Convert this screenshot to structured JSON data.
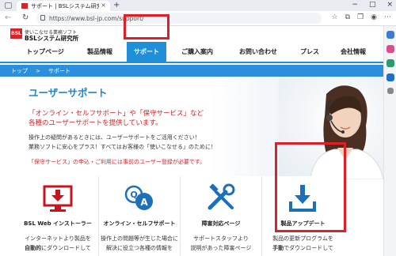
{
  "browser": {
    "tab_title": "サポート | BSLシステム研究所",
    "tab_close": "×",
    "new_tab": "+",
    "url": "https://www.bsl-jp.com/support/",
    "window_controls": [
      "−",
      "□",
      "×"
    ]
  },
  "site": {
    "logo_mark": "BSL",
    "logo_tagline": "使いこなせる業務ソフト",
    "logo_name": "BSLシステム研究所"
  },
  "nav": {
    "items": [
      "トップページ",
      "製品情報",
      "サポート",
      "ご購入案内",
      "お問い合わせ",
      "プレス",
      "会社情報"
    ],
    "active": "サポート"
  },
  "breadcrumb": {
    "home": "トップ",
    "sep": ">",
    "current": "サポート"
  },
  "hero": {
    "title": "ユーザーサポート",
    "lead1": "「オンライン・セルフサポート」や「保守サービス」など",
    "lead2": "各種のユーザーサポートを提供しています。",
    "text1": "操作上の疑問があるときには、ユーザーサポートをご活用ください！",
    "text2": "業務ソフトに安心をプラス！すべてはお客様の「使いこなせる」のために！",
    "note": "「保守サービス」の申込・ご利用には事前のユーザー登録が必要です。"
  },
  "cards": [
    {
      "title": "BSL Web インストーラー",
      "desc1": "インターネットより製品を",
      "desc2_bold": "自動的",
      "desc2_rest": "にダウンロードして",
      "icon": "download-monitor-icon"
    },
    {
      "title": "オンライン・セルフサポート",
      "desc1": "操作上の問題等が生じた場合に",
      "desc2_bold": "",
      "desc2_rest": "解決に役立つ各種の情報を",
      "icon": "qa-bubbles-icon"
    },
    {
      "title": "障害対応ページ",
      "desc1": "サポートスタッフより",
      "desc2_bold": "",
      "desc2_rest": "説明があった障害ページ",
      "icon": "tools-icon"
    },
    {
      "title": "製品アップデート",
      "desc1": "製品の更新プログラムを",
      "desc2_bold": "手動",
      "desc2_rest": "でダウンロードして",
      "icon": "download-tray-icon"
    }
  ],
  "colors": {
    "brand_red": "#d8232a",
    "accent_blue": "#1f8fd8",
    "highlight_red": "#e01e25"
  }
}
